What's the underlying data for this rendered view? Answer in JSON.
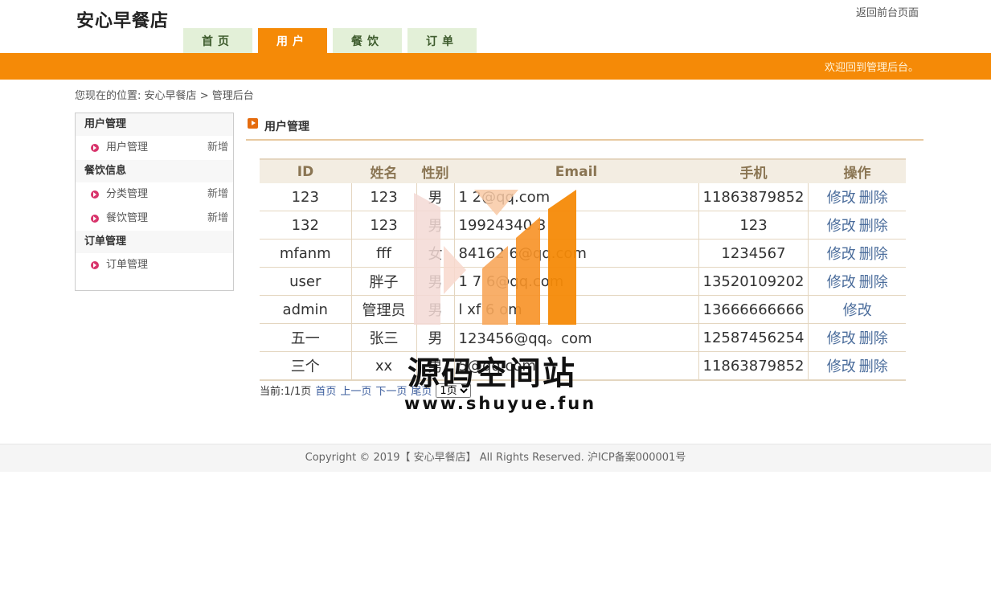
{
  "header": {
    "logo": "安心早餐店",
    "back_link": "返回前台页面",
    "nav": [
      {
        "label": "首页",
        "active": false
      },
      {
        "label": "用户",
        "active": true
      },
      {
        "label": "餐饮",
        "active": false
      },
      {
        "label": "订单",
        "active": false
      }
    ],
    "welcome": "欢迎回到管理后台。"
  },
  "breadcrumb": {
    "prefix": "您现在的位置:",
    "home": "安心早餐店",
    "sep": ">",
    "current": "管理后台"
  },
  "sidebar": {
    "groups": [
      {
        "title": "用户管理",
        "items": [
          {
            "label": "用户管理",
            "add": "新增"
          }
        ]
      },
      {
        "title": "餐饮信息",
        "items": [
          {
            "label": "分类管理",
            "add": "新增"
          },
          {
            "label": "餐饮管理",
            "add": "新增"
          }
        ]
      },
      {
        "title": "订单管理",
        "items": [
          {
            "label": "订单管理",
            "add": ""
          }
        ]
      }
    ]
  },
  "content": {
    "title": "用户管理",
    "table": {
      "headers": [
        "ID",
        "姓名",
        "性别",
        "Email",
        "手机",
        "操作"
      ],
      "rows": [
        {
          "id": "123",
          "name": "123",
          "sex": "男",
          "email": "1       2@qq.com",
          "phone": "11863879852",
          "edit": "修改",
          "delete": "删除"
        },
        {
          "id": "132",
          "name": "123",
          "sex": "男",
          "email": "19924340    3",
          "phone": "123",
          "edit": "修改",
          "delete": "删除"
        },
        {
          "id": "mfanm",
          "name": "fff",
          "sex": "女",
          "email": "84162    6@qq.com",
          "phone": "1234567",
          "edit": "修改",
          "delete": "删除"
        },
        {
          "id": "user",
          "name": "胖子",
          "sex": "男",
          "email": "1    7    6@qq.com",
          "phone": "13520109202",
          "edit": "修改",
          "delete": "删除"
        },
        {
          "id": "admin",
          "name": "管理员",
          "sex": "男",
          "email": "l    xf    6    om",
          "phone": "13666666666",
          "edit": "修改",
          "delete": ""
        },
        {
          "id": "五一",
          "name": "张三",
          "sex": "男",
          "email": "123456@qq。com",
          "phone": "12587456254",
          "edit": "修改",
          "delete": "删除"
        },
        {
          "id": "三个",
          "name": "xx",
          "sex": "男",
          "email": "      5@qq.com",
          "phone": "11863879852",
          "edit": "修改",
          "delete": "删除"
        }
      ]
    },
    "pager": {
      "info": "当前:1/1页",
      "first": "首页",
      "prev": "上一页",
      "next": "下一页",
      "last": "尾页",
      "select_value": "1页"
    }
  },
  "footer": {
    "text": "Copyright © 2019【 安心早餐店】 All Rights Reserved. 沪ICP备案000001号"
  },
  "watermark": {
    "text": "源码空间站",
    "url": "www.shuyue.fun"
  }
}
